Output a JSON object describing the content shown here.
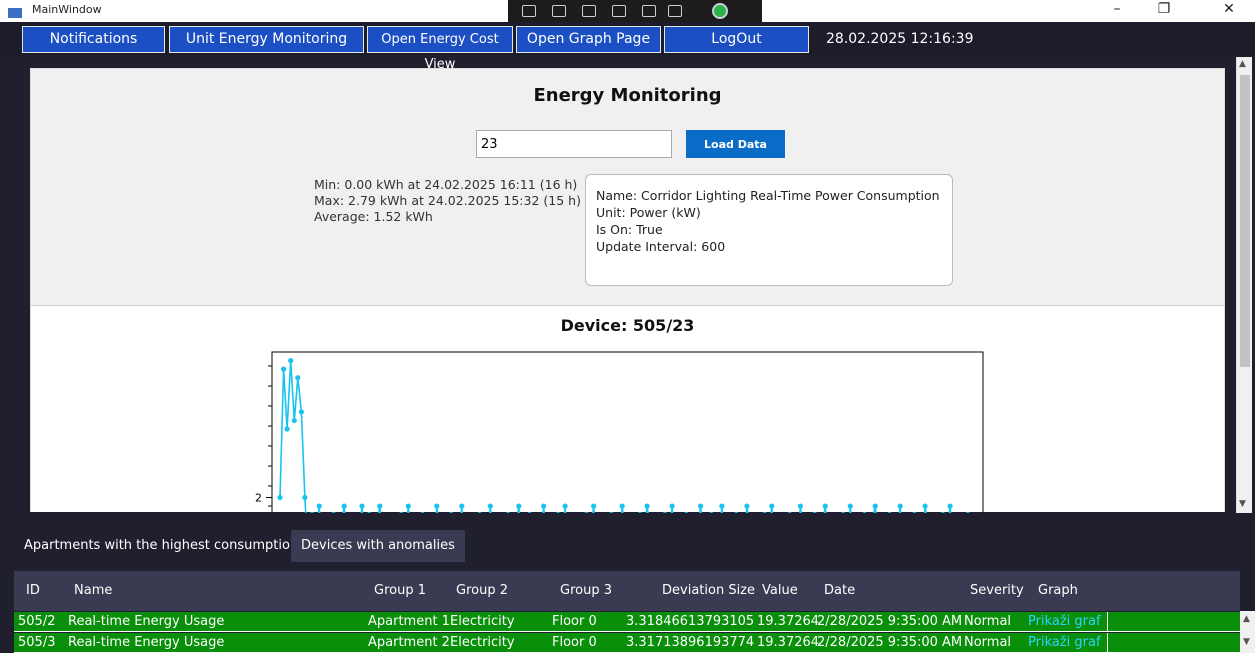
{
  "window": {
    "title": "MainWindow",
    "minimize": "–",
    "maximize": "❐",
    "close": "✕"
  },
  "nav": {
    "notifications": "Notifications",
    "unit_energy": "Unit Energy Monitoring",
    "energy_cost": "Open Energy Cost View",
    "graph_page": "Open Graph Page",
    "logout": "LogOut",
    "datetime": "28.02.2025 12:16:39"
  },
  "monitoring": {
    "title": "Energy Monitoring",
    "device_input_value": "23",
    "load_button": "Load Data",
    "stats": {
      "min": "Min: 0.00 kWh at 24.02.2025 16:11 (16 h)",
      "max": "Max: 2.79 kWh at 24.02.2025 15:32 (15 h)",
      "average": "Average: 1.52 kWh"
    },
    "info": {
      "name": "Name: Corridor Lighting Real-Time Power Consumption",
      "unit": "Unit: Power (kW)",
      "is_on": "Is On: True",
      "update_interval": "Update Interval: 600"
    }
  },
  "chart_data": {
    "type": "line",
    "title": "Device: 505/23",
    "xlabel": "",
    "ylabel": "",
    "y_ticks": [
      "2"
    ],
    "ylim": [
      1.6,
      2.85
    ],
    "grid": false,
    "legend": "none",
    "series": [
      {
        "color": "#19c3f0",
        "values": [
          2.0,
          2.75,
          2.4,
          2.8,
          2.45,
          2.7,
          2.5,
          2.0,
          1.6,
          1.9,
          1.7,
          1.95,
          1.6,
          1.85,
          1.7,
          1.9,
          1.6,
          1.8,
          1.95,
          1.7,
          1.6,
          1.85,
          1.75,
          1.95,
          1.6,
          1.9,
          1.65,
          1.8,
          1.95,
          1.7,
          1.6,
          1.85,
          1.75,
          1.6,
          1.9,
          1.7,
          1.95,
          1.65,
          1.8,
          1.6,
          1.9,
          1.7,
          1.85,
          1.6,
          1.95,
          1.75,
          1.6,
          1.8,
          1.9,
          1.65,
          1.7,
          1.95,
          1.6,
          1.85,
          1.75,
          1.6,
          1.9,
          1.8,
          1.65,
          1.95,
          1.7,
          1.6,
          1.85,
          1.75,
          1.9,
          1.6,
          1.8,
          1.95,
          1.65,
          1.7,
          1.9,
          1.6,
          1.85,
          1.75,
          1.95,
          1.6,
          1.8,
          1.7,
          1.9,
          1.65,
          1.95,
          1.6,
          1.85,
          1.7,
          1.8,
          1.6,
          1.9,
          1.75,
          1.95,
          1.65,
          1.6,
          1.85,
          1.7,
          1.9,
          1.8,
          1.6,
          1.95,
          1.75,
          1.65,
          1.85,
          1.6,
          1.9,
          1.7,
          1.95,
          1.8,
          1.6,
          1.85,
          1.75,
          1.9,
          1.65,
          1.95,
          1.6,
          1.8,
          1.7,
          1.9,
          1.6,
          1.85,
          1.75,
          1.95,
          1.65,
          1.6,
          1.9,
          1.8,
          1.7,
          1.95,
          1.6,
          1.85,
          1.75,
          1.9,
          1.65,
          1.6,
          1.95,
          1.8,
          1.7,
          1.85,
          1.6,
          1.9,
          1.75,
          1.95,
          1.65,
          1.6,
          1.85,
          1.8,
          1.9,
          1.7,
          1.6,
          1.95,
          1.75,
          1.85,
          1.65,
          1.9,
          1.6,
          1.8,
          1.95,
          1.7,
          1.6,
          1.85,
          1.75,
          1.9,
          1.65,
          1.95,
          1.6,
          1.8,
          1.7,
          1.9,
          1.6,
          1.85,
          1.95,
          1.75,
          1.65,
          1.6,
          1.9,
          1.8,
          1.7,
          1.95,
          1.6,
          1.85,
          1.75,
          1.9,
          1.65,
          1.6,
          1.95,
          1.8,
          1.7,
          1.85,
          1.6,
          1.9,
          1.75,
          1.95,
          1.65,
          1.6,
          1.85,
          1.8,
          1.9,
          1.7,
          1.6
        ]
      }
    ]
  },
  "tabs": [
    {
      "label": "Apartments with the highest consumption"
    },
    {
      "label": "Devices with anomalies"
    }
  ],
  "table": {
    "headers": [
      "ID",
      "Name",
      "Group 1",
      "Group 2",
      "Group 3",
      "Deviation Size",
      "Value",
      "Date",
      "Severity",
      "Graph"
    ],
    "rows": [
      [
        "505/2",
        "Real-time Energy Usage",
        "Apartment 1",
        "Electricity",
        "Floor 0",
        "3.31846613793105",
        "19.37264",
        "2/28/2025 9:35:00 AM",
        "Normal",
        "Prikaži graf"
      ],
      [
        "505/3",
        "Real-time Energy Usage",
        "Apartment 2",
        "Electricity",
        "Floor 0",
        "3.31713896193774",
        "19.37264",
        "2/28/2025 9:35:00 AM",
        "Normal",
        "Prikaži graf"
      ]
    ]
  },
  "colors": {
    "nav_button": "#1d4fc4",
    "row_ok": "#0a8f0a",
    "chart_line": "#19c3f0",
    "link": "#2ed4ff"
  }
}
